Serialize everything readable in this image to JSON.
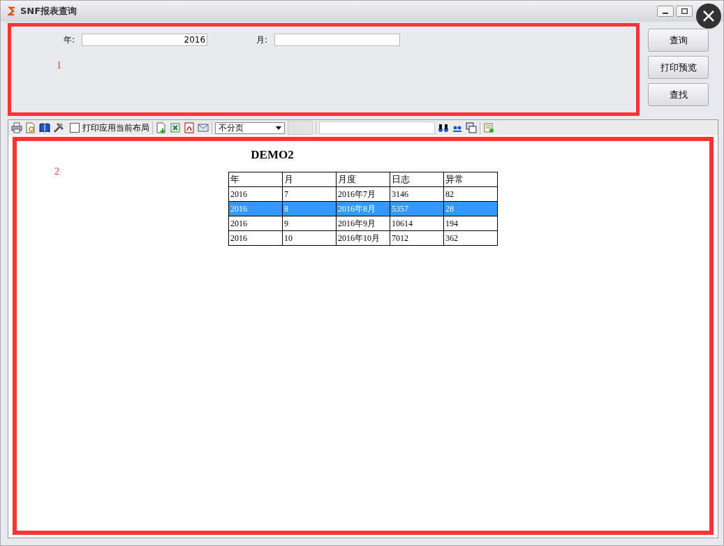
{
  "window": {
    "title": "SNF报表查询"
  },
  "query": {
    "annotation": "1",
    "year": {
      "label": "年:",
      "value": "2016"
    },
    "month": {
      "label": "月:"
    }
  },
  "buttons": [
    "查询",
    "打印预览",
    "查找"
  ],
  "toolbar": {
    "layout_checkbox": {
      "label": "打印应用当前布局",
      "checked": false
    },
    "paging": {
      "value": "不分页"
    }
  },
  "report": {
    "annotation": "2",
    "title": "DEMO2",
    "columns": [
      "年",
      "月",
      "月度",
      "日志",
      "异常"
    ],
    "rows": [
      {
        "cells": [
          "2016",
          "7",
          "2016年7月",
          "3146",
          "82"
        ],
        "selected": false
      },
      {
        "cells": [
          "2016",
          "8",
          "2016年8月",
          "5357",
          "28"
        ],
        "selected": true
      },
      {
        "cells": [
          "2016",
          "9",
          "2016年9月",
          "10614",
          "194"
        ],
        "selected": false
      },
      {
        "cells": [
          "2016",
          "10",
          "2016年10月",
          "7012",
          "362"
        ],
        "selected": false
      }
    ]
  }
}
